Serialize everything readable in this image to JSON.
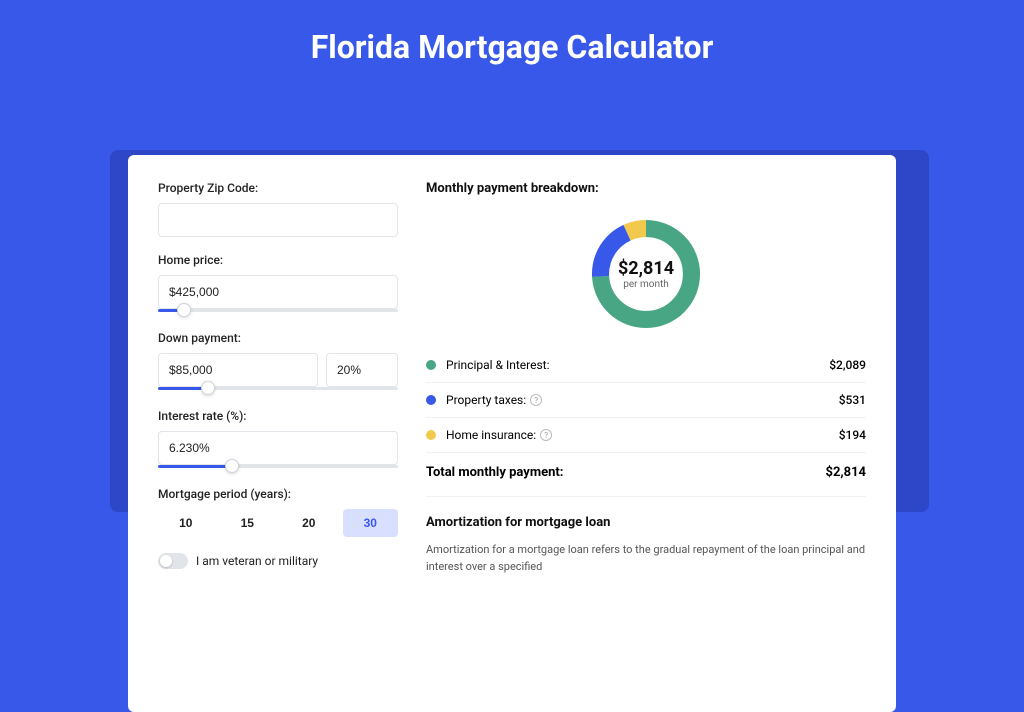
{
  "title": "Florida Mortgage Calculator",
  "form": {
    "zip_label": "Property Zip Code:",
    "zip_value": "",
    "home_price_label": "Home price:",
    "home_price_value": "$425,000",
    "down_payment_label": "Down payment:",
    "down_payment_value": "$85,000",
    "down_payment_pct": "20%",
    "interest_label": "Interest rate (%):",
    "interest_value": "6.230%",
    "period_label": "Mortgage period (years):",
    "period_options": [
      "10",
      "15",
      "20",
      "30"
    ],
    "period_selected": "30",
    "veteran_label": "I am veteran or military"
  },
  "breakdown": {
    "heading": "Monthly payment breakdown:",
    "center_amount": "$2,814",
    "center_sub": "per month",
    "rows": [
      {
        "label": "Principal & Interest:",
        "value": "$2,089",
        "color": "#48a684",
        "help": false
      },
      {
        "label": "Property taxes:",
        "value": "$531",
        "color": "#3858e9",
        "help": true
      },
      {
        "label": "Home insurance:",
        "value": "$194",
        "color": "#f2c94c",
        "help": true
      }
    ],
    "total_label": "Total monthly payment:",
    "total_value": "$2,814"
  },
  "amort": {
    "heading": "Amortization for mortgage loan",
    "text": "Amortization for a mortgage loan refers to the gradual repayment of the loan principal and interest over a specified"
  },
  "chart_data": {
    "type": "pie",
    "title": "Monthly payment breakdown",
    "series": [
      {
        "name": "Principal & Interest",
        "value": 2089,
        "color": "#48a684"
      },
      {
        "name": "Property taxes",
        "value": 531,
        "color": "#3858e9"
      },
      {
        "name": "Home insurance",
        "value": 194,
        "color": "#f2c94c"
      }
    ],
    "total": 2814
  }
}
